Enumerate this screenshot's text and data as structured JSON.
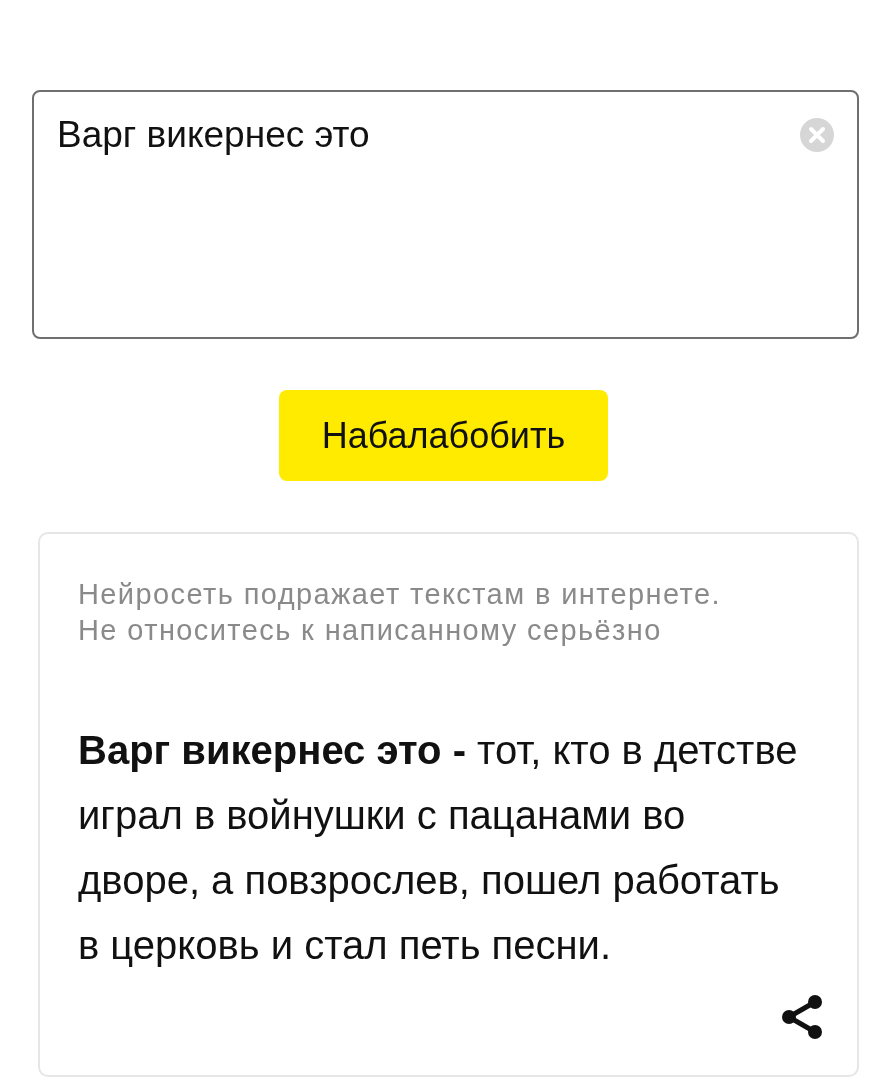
{
  "query_field": {
    "value": "Варг викернес это"
  },
  "submit_button": {
    "label": "Набалабобить"
  },
  "result_card": {
    "disclaimer": "Нейросеть подражает текстам в интернете.\nНе относитесь к написанному серьёзно",
    "text": "**Варг викернес это -** тот, кто в детстве\nиграл в войнушки с пацанами во\nдворе, а повзрослев, пошел работать\nв церковь и стал петь песни."
  }
}
